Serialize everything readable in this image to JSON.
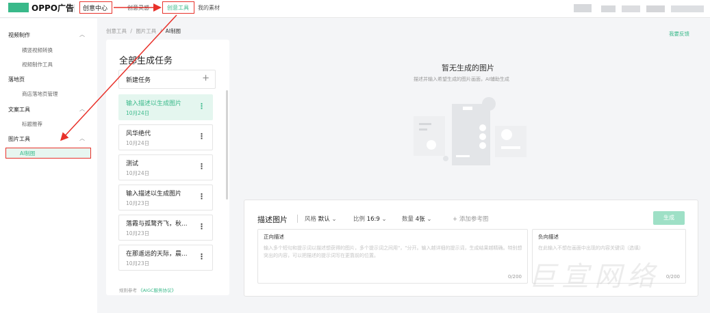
{
  "topbar": {
    "brand": "OPPO广告",
    "center": "创意中心",
    "nav": [
      "创意灵感",
      "创意工具",
      "我的素材"
    ],
    "active_nav": "创意工具"
  },
  "sidebar": {
    "groups": [
      {
        "label": "视频制作",
        "items": [
          "横竖视频转换",
          "视频制作工具"
        ]
      },
      {
        "label": "落地页",
        "items": [
          "商店落地页管理"
        ]
      },
      {
        "label": "文案工具",
        "items": [
          "标题推荐"
        ]
      },
      {
        "label": "图片工具",
        "items": [
          "AI制图"
        ]
      }
    ],
    "active_item": "AI制图"
  },
  "breadcrumb": {
    "items": [
      "创意工具",
      "图片工具"
    ],
    "current": "AI制图",
    "sep": "/"
  },
  "feedback": "我要反馈",
  "tasks": {
    "title": "全部生成任务",
    "new_task": "新建任务",
    "items": [
      {
        "name": "输入描述以生成图片",
        "date": "10月24日"
      },
      {
        "name": "风华绝代",
        "date": "10月24日"
      },
      {
        "name": "测试",
        "date": "10月24日"
      },
      {
        "name": "输入描述以生成图片",
        "date": "10月23日"
      },
      {
        "name": "落霞与孤鹜齐飞，秋...",
        "date": "10月23日"
      },
      {
        "name": "在那遥远的天际，晨...",
        "date": "10月23日"
      }
    ],
    "rules_prefix": "规则参考",
    "rules_link": "《AIGC服务协议》"
  },
  "empty": {
    "title": "暂无生成的图片",
    "subtitle": "描述并输入希望生成的图片画面，AI辅助生成"
  },
  "prompt": {
    "title": "描述图片",
    "style_label": "风格",
    "style_value": "默认",
    "ratio_label": "比例",
    "ratio_value": "16:9",
    "count_label": "数量",
    "count_value": "4张",
    "add_ref": "添加参考图",
    "generate": "生成",
    "positive": {
      "label": "正向描述",
      "placeholder": "输入多个短句和提示词以描述想获得的图片，多个提示词之间用\"，\"分开。输入越详细的提示词，生成结果越精确。特别想突出的内容，可以把描述的提示词写在更靠前的位置。",
      "count": "0/200"
    },
    "negative": {
      "label": "负向描述",
      "placeholder": "在此输入不想在画面中出现的内容关键词（选填）",
      "count": "0/200"
    }
  },
  "watermark": "巨宣网络",
  "colors": {
    "accent": "#39b98a",
    "annotation": "#e8312a"
  }
}
